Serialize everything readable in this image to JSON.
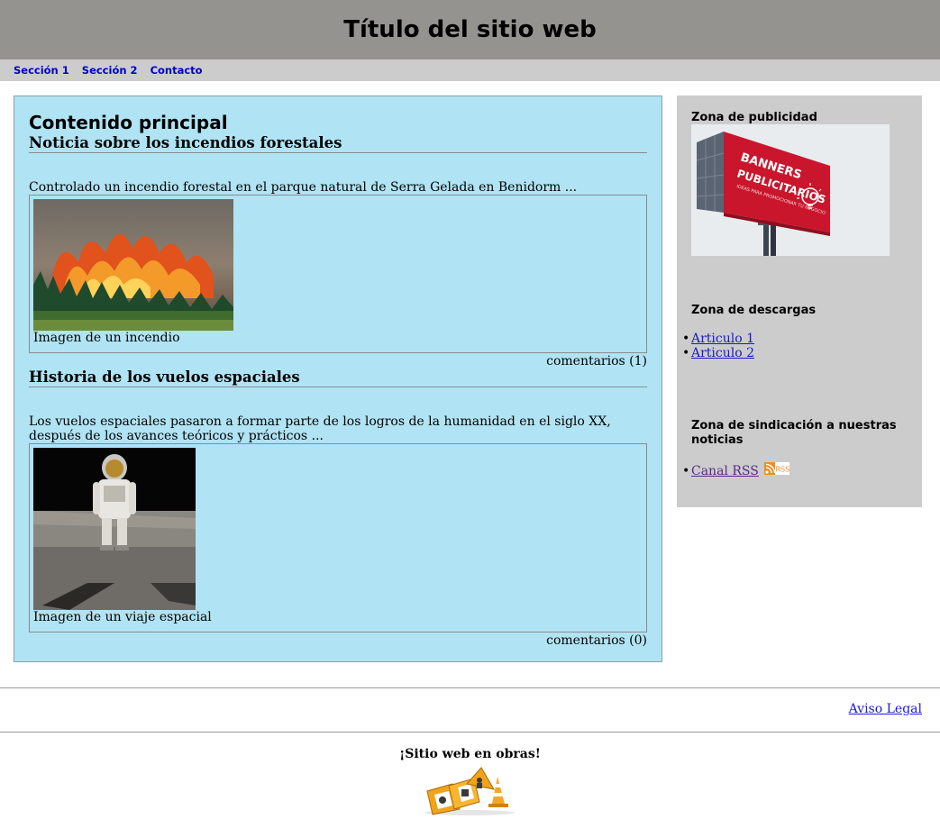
{
  "header": {
    "title": "Título del sitio web"
  },
  "nav": {
    "items": [
      "Sección 1",
      "Sección 2",
      "Contacto"
    ]
  },
  "main": {
    "title": "Contenido principal",
    "articles": [
      {
        "title": "Noticia sobre los incendios forestales",
        "summary": "Controlado un incendio forestal en el parque natural de Serra Gelada en Benidorm ...",
        "caption": "Imagen de un incendio",
        "comments": "comentarios (1)"
      },
      {
        "title": "Historia de los vuelos espaciales",
        "summary": "Los vuelos espaciales pasaron a formar parte de los logros de la humanidad en el siglo XX, después de los avances teóricos y prácticos ...",
        "caption": "Imagen de un viaje espacial",
        "comments": "comentarios (0)"
      }
    ]
  },
  "sidebar": {
    "ads": {
      "heading": "Zona de publicidad",
      "billboard_line1": "BANNERS",
      "billboard_line2": "PUBLICITARIOS",
      "billboard_small": "IDEAS PARA PROMOCIONAR TU NEGOCIO"
    },
    "downloads": {
      "heading": "Zona de descargas",
      "items": [
        "Articulo 1",
        "Articulo 2"
      ]
    },
    "syndication": {
      "heading": "Zona de sindicación a nuestras noticias",
      "rss_link": "Canal RSS",
      "rss_badge": "RSS"
    }
  },
  "footer": {
    "legal": "Aviso Legal",
    "works": "¡Sitio web en obras!"
  },
  "colors": {
    "header_bg": "#94938f",
    "nav_bg": "#cccccc",
    "main_bg": "#b0e3f3",
    "sidebar_bg": "#cccccc",
    "link": "#1a1acc"
  },
  "icons": [
    "rss-icon",
    "under-construction-icon"
  ]
}
